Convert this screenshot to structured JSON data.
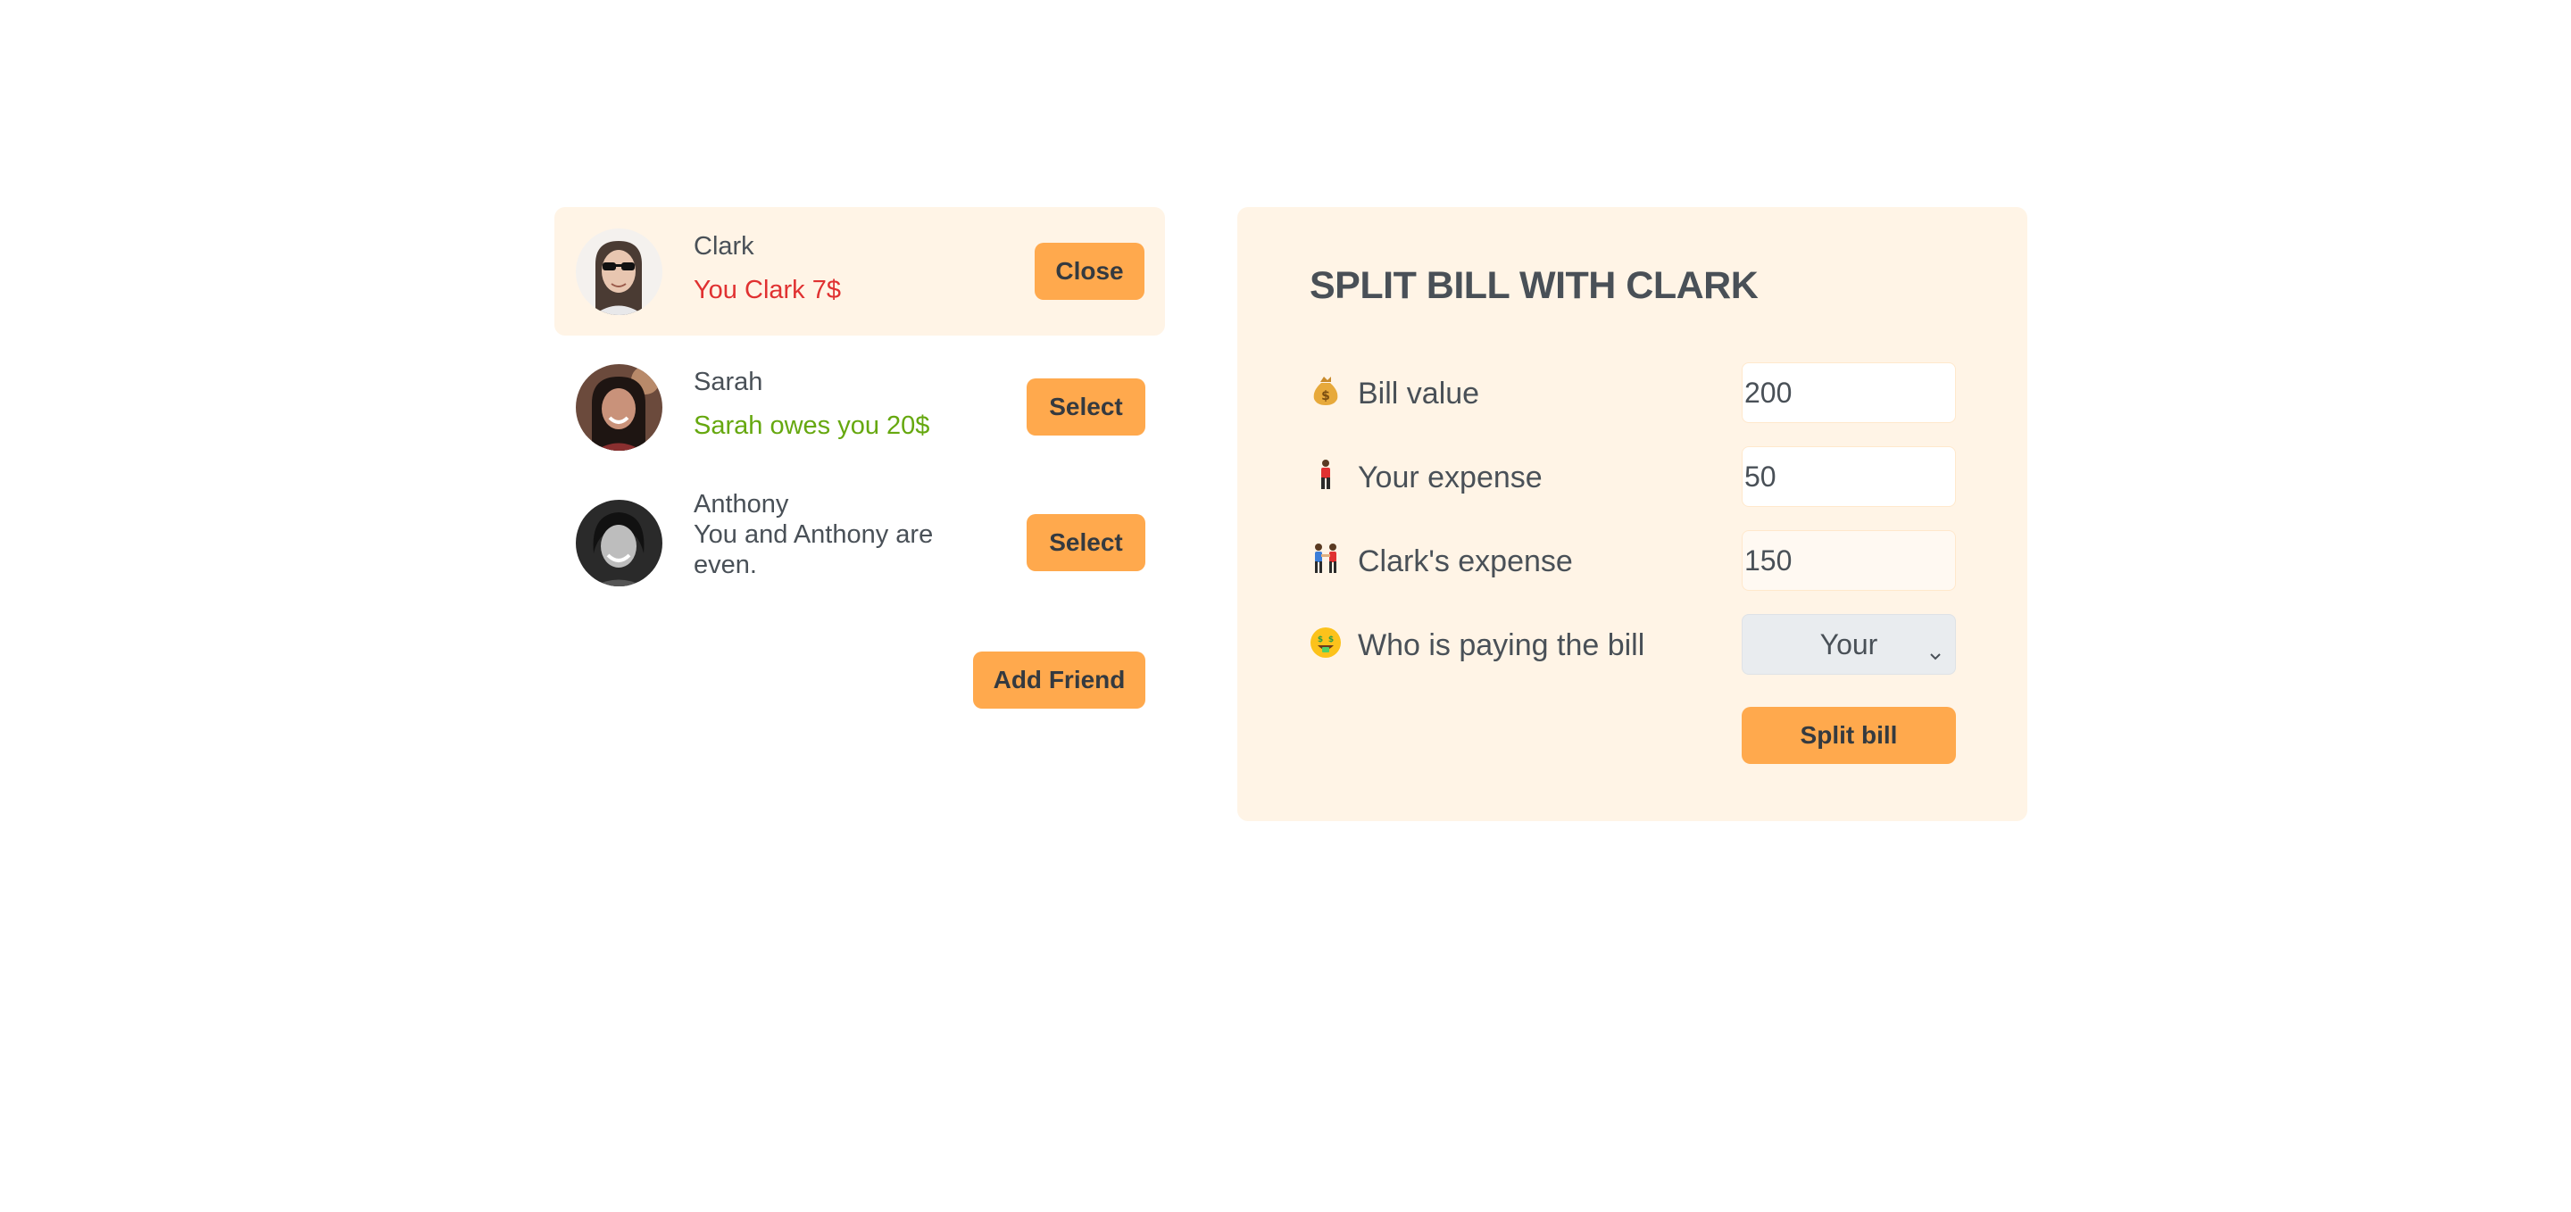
{
  "friends": [
    {
      "name": "Clark",
      "status": "You Clark 7$",
      "button": "Close",
      "selected": true
    },
    {
      "name": "Sarah",
      "status": "Sarah owes you 20$",
      "button": "Select",
      "selected": false
    },
    {
      "name": "Anthony",
      "status": "You and Anthony are even.",
      "button": "Select",
      "selected": false
    }
  ],
  "add_friend_label": "Add Friend",
  "split_form": {
    "title": "SPLIT BILL WITH CLARK",
    "bill_value_label": "Bill value",
    "bill_value": "200",
    "your_expense_label": "Your expense",
    "your_expense": "50",
    "friend_expense_label": "Clark's expense",
    "friend_expense": "150",
    "payer_label": "Who is paying the bill",
    "payer_value": "Your",
    "submit_label": "Split bill"
  },
  "icons": {
    "bill_value": "money-bag-icon",
    "your_expense": "person-standing-icon",
    "friend_expense": "two-people-icon",
    "payer": "money-mouth-face-icon",
    "select_arrow": "chevron-down-icon"
  },
  "colors": {
    "accent": "#ffa94d",
    "panel_bg": "#fff4e6",
    "owe_red": "#e03131",
    "owed_green": "#66a80f",
    "text": "#495057"
  }
}
